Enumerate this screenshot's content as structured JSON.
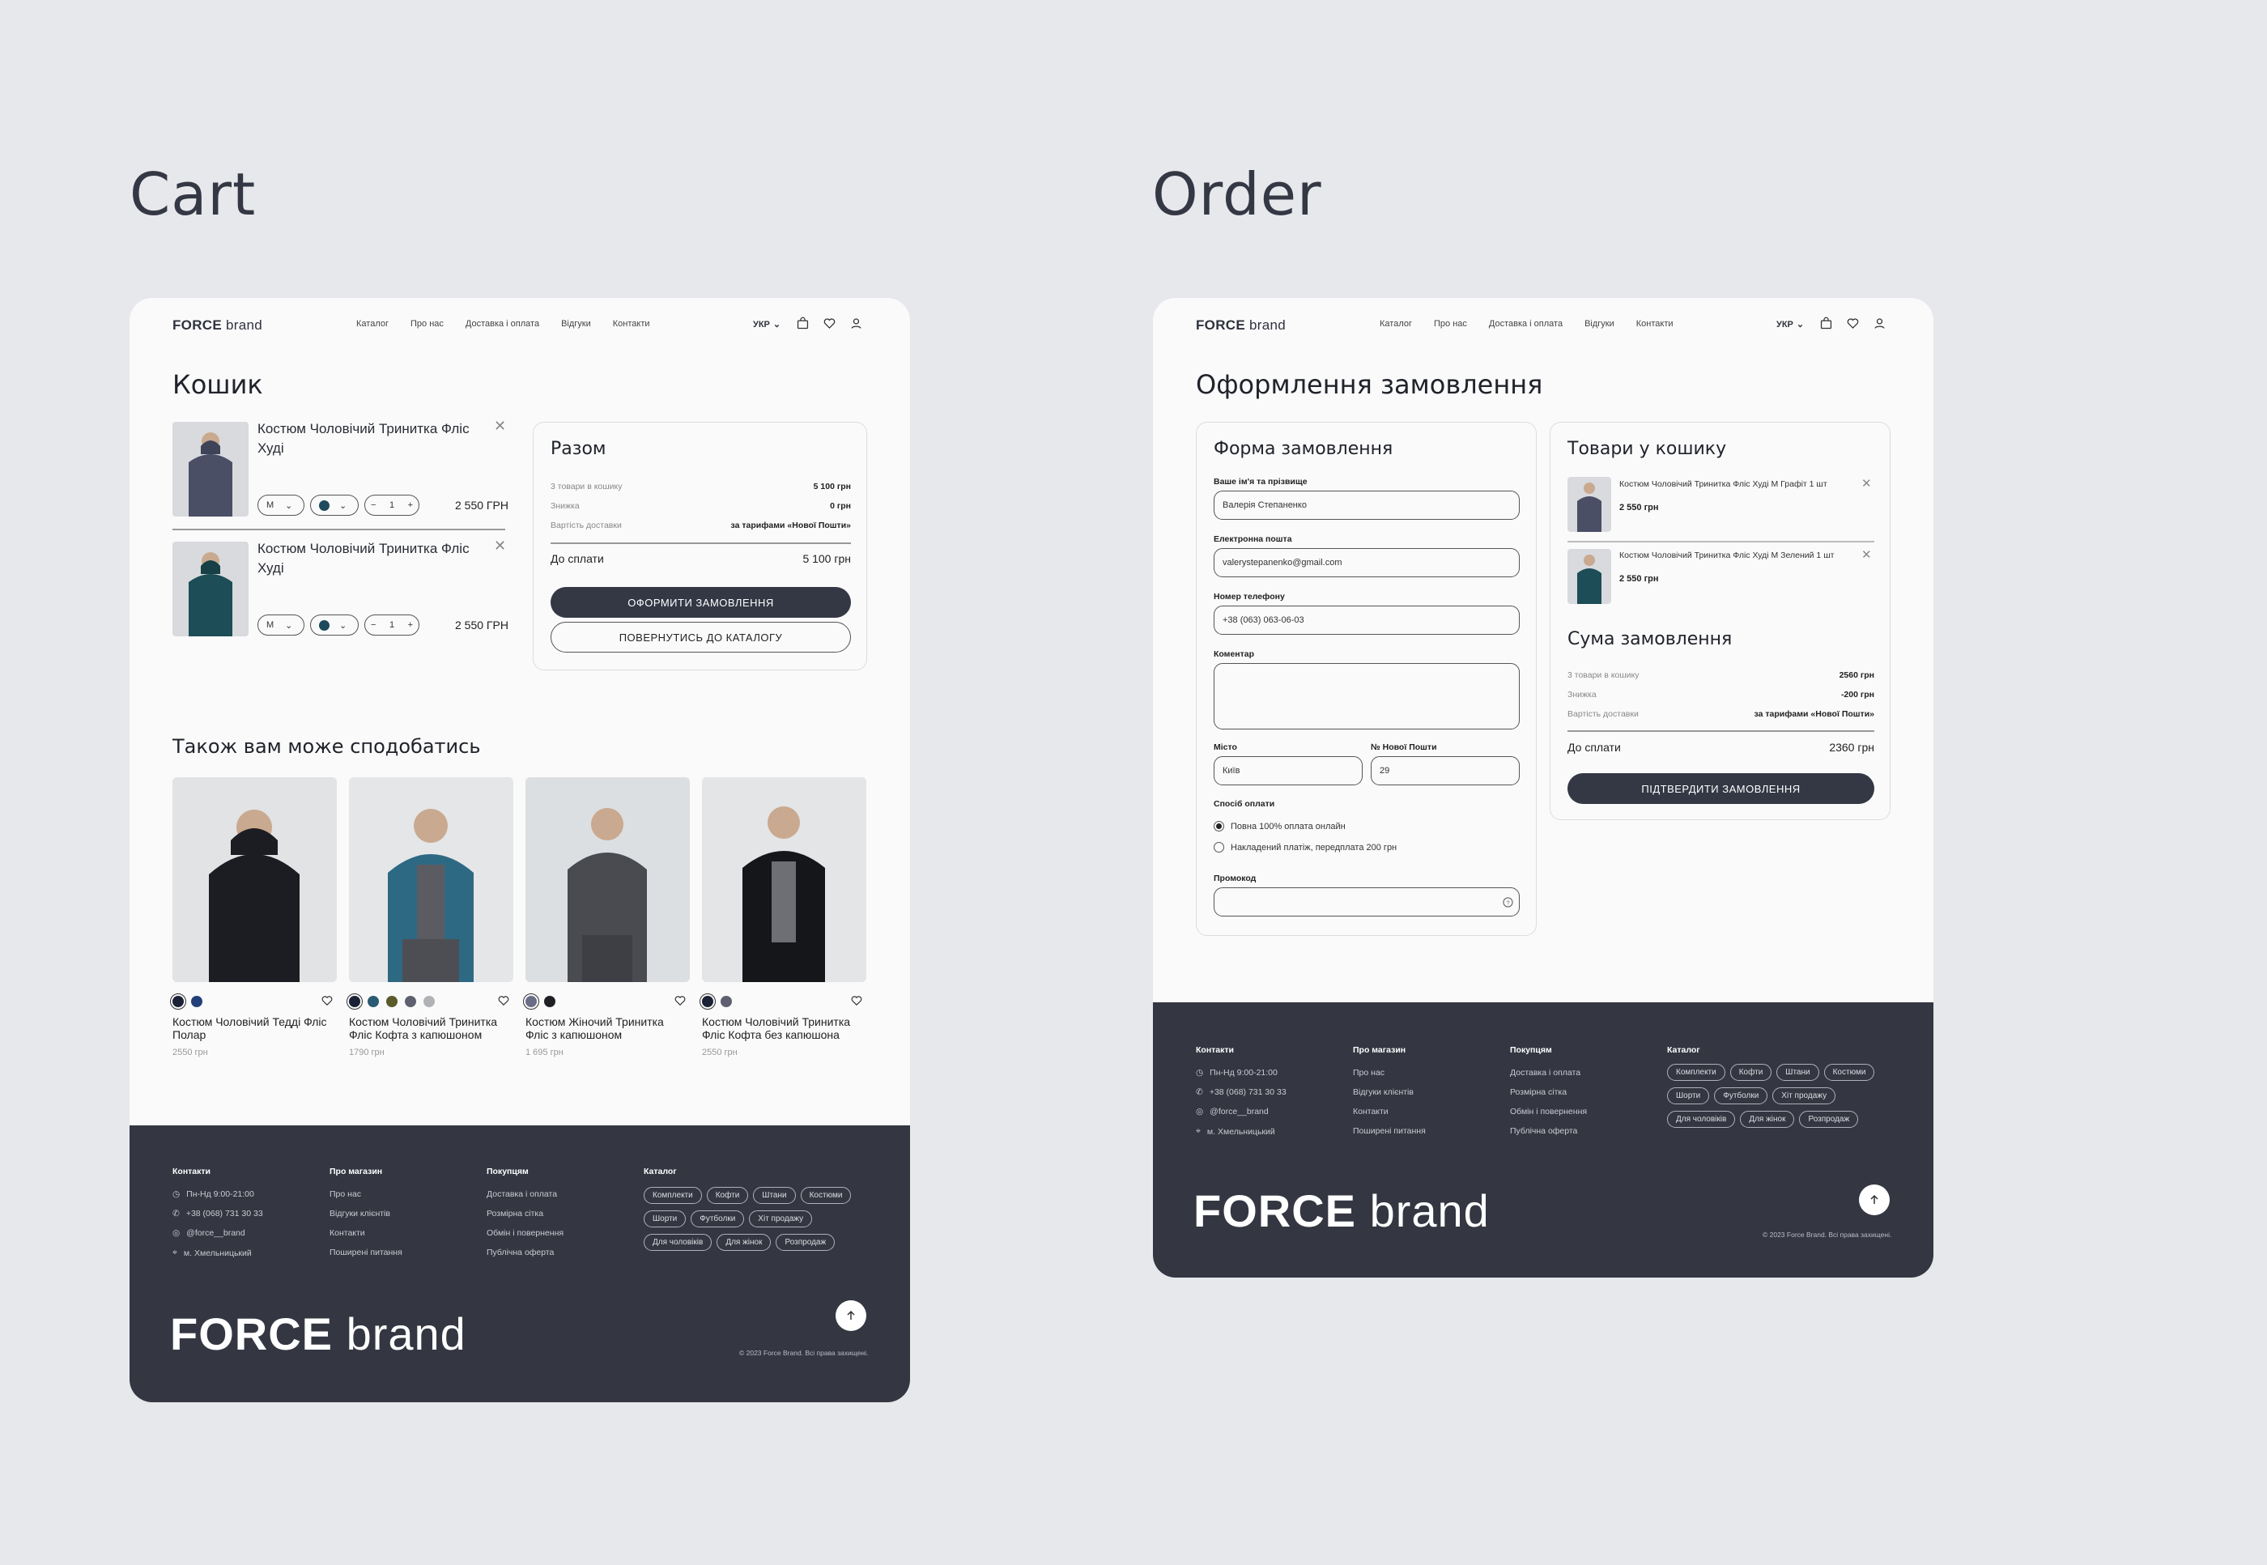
{
  "headings": {
    "cart": "Cart",
    "order": "Order"
  },
  "nav": {
    "logo_bold": "FORCE",
    "logo_light": "brand",
    "items": [
      "Каталог",
      "Про нас",
      "Доставка і оплата",
      "Відгуки",
      "Контакти"
    ],
    "lang": "УКР"
  },
  "cart": {
    "title": "Кошик",
    "items": [
      {
        "name": "Костюм Чоловічий Тринитка Фліс Худі",
        "size": "M",
        "qty": "1",
        "price": "2 550 ГРН",
        "color": "#1e4a5c"
      },
      {
        "name": "Костюм Чоловічий Тринитка Фліс Худі",
        "size": "M",
        "qty": "1",
        "price": "2 550 ГРН",
        "color": "#1e4a5c"
      }
    ],
    "summary": {
      "title": "Разом",
      "rows": [
        {
          "label": "3 товари в кошику",
          "value": "5 100 грн"
        },
        {
          "label": "Знижка",
          "value": "0 грн"
        },
        {
          "label": "Вартість доставки",
          "value": "за тарифами «Нової Пошти»"
        }
      ],
      "total_label": "До сплати",
      "total_value": "5 100 грн",
      "checkout": "ОФОРМИТИ ЗАМОВЛЕННЯ",
      "back": "ПОВЕРНУТИСЬ ДО КАТАЛОГУ"
    },
    "recs_title": "Також вам може сподобатись",
    "recs": [
      {
        "name": "Костюм Чоловічий Тедді Фліс Полар",
        "price": "2550 грн",
        "swatches": [
          "#1b2236",
          "#23407a"
        ],
        "img_bg": "#e1e3e5",
        "garment": "#1c1d22"
      },
      {
        "name": "Костюм Чоловічий Тринитка Фліс Кофта з капюшоном",
        "price": "1790 грн",
        "swatches": [
          "#1b2236",
          "#2a5b73",
          "#5a5a2a",
          "#5e6070",
          "#b0b2b6"
        ],
        "img_bg": "#e4e6e8",
        "garment": "#2e6984"
      },
      {
        "name": "Костюм Жіночий Тринитка Фліс з капюшоном",
        "price": "1 695 грн",
        "swatches": [
          "#6a6d86",
          "#1f2024"
        ],
        "img_bg": "#dcdfe1",
        "garment": "#4a4b50"
      },
      {
        "name": "Костюм Чоловічий Тринитка Фліс Кофта без капюшона",
        "price": "2550 грн",
        "swatches": [
          "#1b2236",
          "#5e6070"
        ],
        "img_bg": "#e3e5e7",
        "garment": "#15161a"
      }
    ]
  },
  "order": {
    "title": "Оформлення замовлення",
    "form": {
      "title": "Форма замовлення",
      "name_label": "Ваше ім'я та прізвище",
      "name_value": "Валерія Степаненко",
      "email_label": "Електронна пошта",
      "email_value": "valerystepanenko@gmail.com",
      "phone_label": "Номер телефону",
      "phone_value": "+38 (063) 063-06-03",
      "comment_label": "Коментар",
      "city_label": "Місто",
      "city_value": "Київ",
      "np_label": "№ Нової Пошти",
      "np_value": "29",
      "payment_label": "Спосіб оплати",
      "payment_options": [
        "Повна 100% оплата онлайн",
        "Накладений платіж, передплата 200 грн"
      ],
      "promo_label": "Промокод"
    },
    "cart_title": "Товари у кошику",
    "items": [
      {
        "name": "Костюм Чоловічий Тринитка Фліс Худі M Графіт 1 шт",
        "price": "2 550 грн",
        "color": "#4a4f66"
      },
      {
        "name": "Костюм Чоловічий Тринитка Фліс Худі M Зелений 1 шт",
        "price": "2 550 грн",
        "color": "#1d4d56"
      }
    ],
    "sum_title": "Сума замовлення",
    "rows": [
      {
        "label": "3 товари в кошику",
        "value": "2560 грн"
      },
      {
        "label": "Знижка",
        "value": "-200 грн"
      },
      {
        "label": "Вартість доставки",
        "value": "за тарифами «Нової Пошти»"
      }
    ],
    "total_label": "До сплати",
    "total_value": "2360 грн",
    "confirm": "ПІДТВЕРДИТИ ЗАМОВЛЕННЯ"
  },
  "footer": {
    "contacts": {
      "title": "Контакти",
      "items": [
        "Пн-Нд 9:00-21:00",
        "+38 (068) 731 30 33",
        "@force__brand",
        "м. Хмельницький"
      ]
    },
    "about": {
      "title": "Про магазин",
      "items": [
        "Про нас",
        "Відгуки клієнтів",
        "Контакти",
        "Поширені питання"
      ]
    },
    "buyers": {
      "title": "Покупцям",
      "items": [
        "Доставка і оплата",
        "Розмірна сітка",
        "Обмін і повернення",
        "Публічна оферта"
      ]
    },
    "catalog": {
      "title": "Каталог",
      "tags": [
        "Комплекти",
        "Кофти",
        "Штани",
        "Костюми",
        "Шорти",
        "Футболки",
        "Хіт продажу",
        "Для чоловіків",
        "Для жінок",
        "Розпродаж"
      ]
    },
    "copyright": "© 2023 Force Brand. Всі права захищені."
  },
  "colors": {
    "dark": "#343742",
    "page": "#fafafa",
    "bg": "#e7e8ec"
  }
}
